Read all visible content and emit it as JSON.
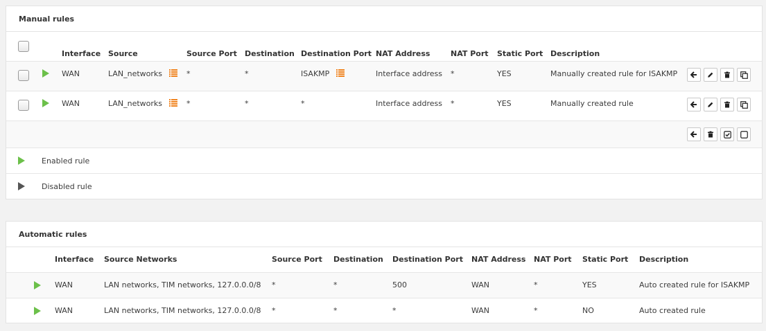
{
  "manual": {
    "title": "Manual rules",
    "headers": {
      "interface": "Interface",
      "source": "Source",
      "source_port": "Source Port",
      "destination": "Destination",
      "destination_port": "Destination Port",
      "nat_address": "NAT Address",
      "nat_port": "NAT Port",
      "static_port": "Static Port",
      "description": "Description"
    },
    "rows": [
      {
        "interface": "WAN",
        "source": "LAN_networks",
        "source_port": "*",
        "destination": "*",
        "destination_port": "ISAKMP",
        "nat_address": "Interface address",
        "nat_port": "*",
        "static_port": "YES",
        "description": "Manually created rule for ISAKMP"
      },
      {
        "interface": "WAN",
        "source": "LAN_networks",
        "source_port": "*",
        "destination": "*",
        "destination_port": "*",
        "nat_address": "Interface address",
        "nat_port": "*",
        "static_port": "YES",
        "description": "Manually created rule"
      }
    ],
    "legend": {
      "enabled": "Enabled rule",
      "disabled": "Disabled rule"
    }
  },
  "automatic": {
    "title": "Automatic rules",
    "headers": {
      "interface": "Interface",
      "source_networks": "Source Networks",
      "source_port": "Source Port",
      "destination": "Destination",
      "destination_port": "Destination Port",
      "nat_address": "NAT Address",
      "nat_port": "NAT Port",
      "static_port": "Static Port",
      "description": "Description"
    },
    "rows": [
      {
        "interface": "WAN",
        "source_networks": "LAN networks, TIM networks, 127.0.0.0/8",
        "source_port": "*",
        "destination": "*",
        "destination_port": "500",
        "nat_address": "WAN",
        "nat_port": "*",
        "static_port": "YES",
        "description": "Auto created rule for ISAKMP"
      },
      {
        "interface": "WAN",
        "source_networks": "LAN networks, TIM networks, 127.0.0.0/8",
        "source_port": "*",
        "destination": "*",
        "destination_port": "*",
        "nat_address": "WAN",
        "nat_port": "*",
        "static_port": "NO",
        "description": "Auto created rule"
      }
    ]
  },
  "colors": {
    "enabled": "#6cc04a",
    "disabled": "#555555",
    "alias_icon": "#f0831e"
  },
  "icons": {
    "enabled_rule": "play-icon",
    "alias_list": "list-icon",
    "move": "arrow-left-icon",
    "edit": "pencil-icon",
    "delete": "trash-icon",
    "clone": "clone-icon",
    "enable_all": "check-square-icon",
    "disable_all": "square-icon"
  }
}
